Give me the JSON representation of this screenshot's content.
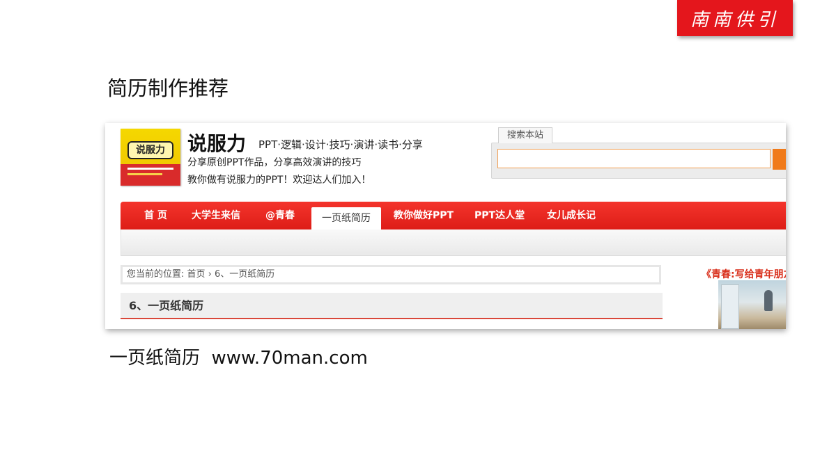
{
  "badge": {
    "text": "南南供引"
  },
  "slide": {
    "title": "简历制作推荐",
    "caption": "一页纸简历  www.70man.com"
  },
  "website": {
    "logo_book_text": "说服力",
    "site_name": "说服力",
    "tagline": "PPT·逻辑·设计·技巧·演讲·读书·分享",
    "description_lines": [
      "分享原创PPT作品，分享高效演讲的技巧",
      "教你做有说服力的PPT！欢迎达人们加入！"
    ],
    "search": {
      "tab_label": "搜索本站",
      "value": "",
      "placeholder": ""
    },
    "nav": [
      {
        "label": "首 页",
        "active": false
      },
      {
        "label": "大学生来信",
        "active": false
      },
      {
        "label": "@青春",
        "active": false
      },
      {
        "label": "一页纸简历",
        "active": true
      },
      {
        "label": "教你做好PPT",
        "active": false
      },
      {
        "label": "PPT达人堂",
        "active": false
      },
      {
        "label": "女儿成长记",
        "active": false
      }
    ],
    "breadcrumb": "您当前的位置: 首页 › 6、一页纸简历",
    "section_title": "6、一页纸简历",
    "sidebar_promo": "《青春:写给青年朋友"
  },
  "colors": {
    "accent_red": "#e4161c",
    "nav_red": "#ea2a22",
    "search_orange": "#f07a1a"
  }
}
